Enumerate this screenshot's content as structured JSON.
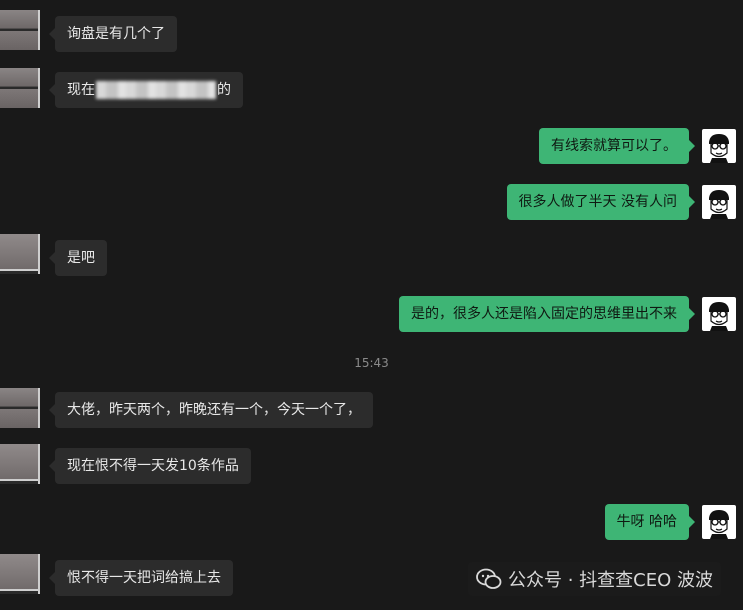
{
  "messages": [
    {
      "side": "left",
      "text": "询盘是有几个了"
    },
    {
      "side": "left",
      "text_prefix": "现在",
      "text_suffix": "的",
      "redacted": true
    },
    {
      "side": "right",
      "text": "有线索就算可以了。"
    },
    {
      "side": "right",
      "text": "很多人做了半天 没有人问"
    },
    {
      "side": "left",
      "text": "是吧"
    },
    {
      "side": "right",
      "text": "是的，很多人还是陷入固定的思维里出不来"
    },
    {
      "side": "left",
      "text": "大佬，昨天两个，昨晚还有一个，今天一个了，"
    },
    {
      "side": "left",
      "text": "现在恨不得一天发10条作品"
    },
    {
      "side": "right",
      "text": "牛呀 哈哈"
    },
    {
      "side": "left",
      "text": "恨不得一天把词给搞上去"
    }
  ],
  "timestamp": "15:43",
  "watermark": {
    "text": "公众号 · 抖查查CEO 波波",
    "icon": "wechat-icon"
  },
  "colors": {
    "background": "#191919",
    "incoming_bubble": "#2c2c2c",
    "outgoing_bubble": "#3eb575"
  }
}
